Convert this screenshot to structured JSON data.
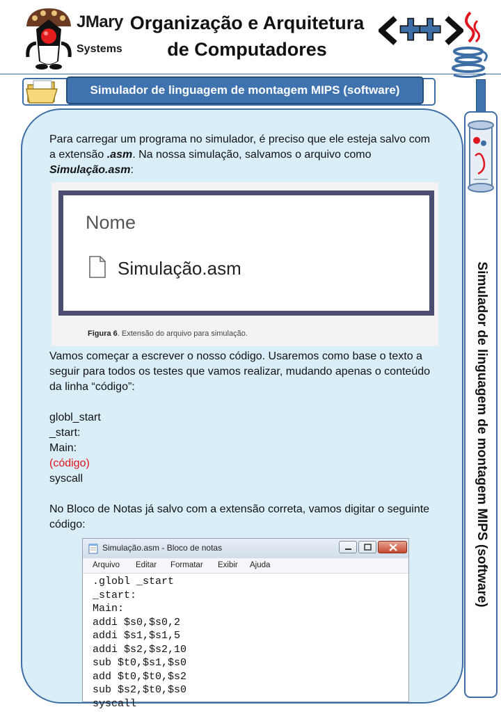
{
  "header": {
    "logo_line1": "JMary",
    "logo_line2": "Systems",
    "title_line1": "Organização e Arquitetura",
    "title_line2": "de Computadores",
    "cpp_logo_text": "<++>"
  },
  "banner": {
    "label": "Simulador de linguagem de montagem MIPS (software)"
  },
  "sidebar": {
    "label": "Simulador de linguagem de montagem MIPS (software)"
  },
  "content": {
    "p1_a": "Para carregar um programa no simulador, é preciso que ele esteja salvo com a extensão ",
    "p1_ext": ".asm",
    "p1_b": ". Na nossa simulação, salvamos o arquivo como ",
    "p1_file": "Simulação.asm",
    "p1_c": ":",
    "figure": {
      "column_header": "Nome",
      "file_name": "Simulação.asm",
      "caption_label": "Figura 6",
      "caption_text": ". Extensão do arquivo para simulação."
    },
    "p2": "Vamos começar a escrever o nosso código. Usaremos como base o texto a seguir para todos os testes que vamos realizar, mudando apenas o conteúdo da linha “código”:",
    "template_lines": [
      "globl_start",
      "_start:",
      "Main:",
      "(código)",
      "syscall"
    ],
    "p3": "No Bloco de Notas já salvo com a extensão correta, vamos digitar o seguinte código:",
    "notepad": {
      "title": "Simulação.asm - Bloco de notas",
      "menu": [
        "Arquivo",
        "Editar",
        "Formatar",
        "Exibir",
        "Ajuda"
      ],
      "code_lines": [
        ".globl _start",
        "_start:",
        "Main:",
        "addi $s0,$s0,2",
        "addi $s1,$s1,5",
        "addi $s2,$s2,10",
        "sub $t0,$s1,$s0",
        "add $t0,$t0,$s2",
        "sub $s2,$t0,$s0",
        "syscall"
      ]
    }
  },
  "colors": {
    "accent": "#3e73b0",
    "panel": "#daeef8",
    "highlight": "#e0141e"
  }
}
